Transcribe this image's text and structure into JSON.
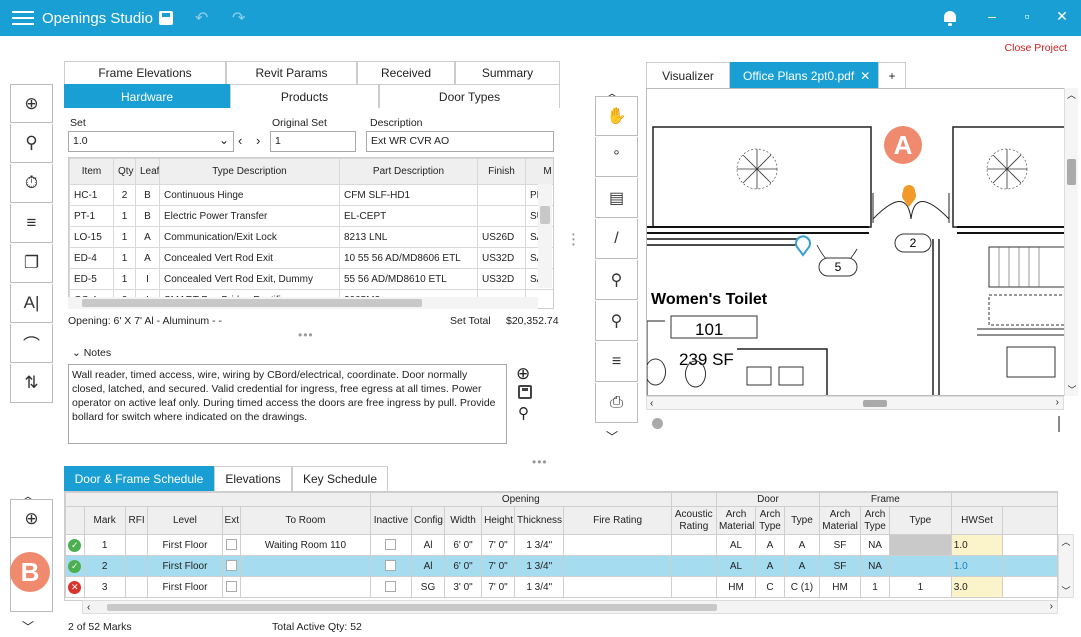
{
  "app": {
    "title": "Openings Studio",
    "close_project": "Close Project"
  },
  "left_toolbar": [
    {
      "icon": "add-icon",
      "glyph": "⊕"
    },
    {
      "icon": "search-icon",
      "glyph": "⚲"
    },
    {
      "icon": "timer-icon",
      "glyph": "⏱"
    },
    {
      "icon": "filter-icon",
      "glyph": "≡"
    },
    {
      "icon": "copy-icon",
      "glyph": "❐"
    },
    {
      "icon": "text-edit-icon",
      "glyph": "A|"
    },
    {
      "icon": "attach-icon",
      "glyph": "⌒"
    },
    {
      "icon": "sort-icon",
      "glyph": "⇅"
    }
  ],
  "tabs_top": [
    "Frame Elevations",
    "Revit Params",
    "Received",
    "Summary"
  ],
  "tabs_second": [
    "Hardware",
    "Products",
    "Door Types"
  ],
  "set": {
    "label": "Set",
    "value": "1.0",
    "original_label": "Original Set",
    "original_value": "1",
    "desc_label": "Description",
    "desc_value": "Ext WR CVR AO"
  },
  "hardware": {
    "headers": [
      "Item",
      "Qty",
      "Leaf",
      "Type Description",
      "Part Description",
      "Finish",
      "M"
    ],
    "rows": [
      [
        "HC-1",
        "2",
        "B",
        "Continuous Hinge",
        "CFM SLF-HD1",
        "",
        "PE"
      ],
      [
        "PT-1",
        "1",
        "B",
        "Electric Power Transfer",
        "EL-CEPT",
        "",
        "SU"
      ],
      [
        "LO-15",
        "1",
        "A",
        "Communication/Exit Lock",
        "8213 LNL",
        "US26D",
        "SA"
      ],
      [
        "ED-4",
        "1",
        "A",
        "Concealed Vert Rod Exit",
        "10 55 56 AD/MD8606 ETL",
        "US32D",
        "SA"
      ],
      [
        "ED-5",
        "1",
        "I",
        "Concealed Vert Rod Exit, Dummy",
        "55 56 AD/MD8610 ETL",
        "US32D",
        "SA"
      ],
      [
        "CC 4",
        "2",
        "I",
        "SMART Pac Bridge Rectifier",
        "2005M3",
        "",
        ""
      ]
    ],
    "opening": "Opening:  6' X 7' Al - Aluminum -  -",
    "set_total_label": "Set Total",
    "set_total": "$20,352.74"
  },
  "notes": {
    "label": "Notes",
    "text": "Wall reader, timed access, wire, wiring by CBord/electrical, coordinate.  Door normally closed, latched, and secured.  Valid credential for ingress, free egress at all times.  Power operator on active leaf only.  During timed access the doors are free ingress by pull.  Provide bollard for switch where indicated on the drawings."
  },
  "viewer": {
    "tab1": "Visualizer",
    "tab2": "Office Plans 2pt0.pdf",
    "add": "+",
    "room_name": "Women's Toilet",
    "room_num": "101",
    "room_area": "239 SF",
    "tag1": "2",
    "tag2": "5",
    "badge_a": "A",
    "badge_b": "B"
  },
  "right_toolbar": [
    {
      "icon": "hand-icon",
      "glyph": "✋"
    },
    {
      "icon": "degree-icon",
      "glyph": "°"
    },
    {
      "icon": "document-search-icon",
      "glyph": "▤"
    },
    {
      "icon": "line-icon",
      "glyph": "/"
    },
    {
      "icon": "pin-icon",
      "glyph": "⚲"
    },
    {
      "icon": "pin-list-icon",
      "glyph": "⚲"
    },
    {
      "icon": "menu-icon",
      "glyph": "≡"
    },
    {
      "icon": "stamp-icon",
      "glyph": "⎙"
    }
  ],
  "sched_tabs": [
    "Door & Frame Schedule",
    "Elevations",
    "Key Schedule"
  ],
  "schedule": {
    "groups": {
      "opening": "Opening",
      "door": "Door",
      "frame": "Frame"
    },
    "headers": [
      "Mark",
      "RFI",
      "Level",
      "Ext",
      "To Room",
      "Inactive",
      "Config",
      "Width",
      "Height",
      "Thickness",
      "Fire Rating",
      "Acoustic Rating",
      "Arch Material",
      "Arch Type",
      "Type",
      "Arch Material",
      "Arch Type",
      "Type",
      "HWSet"
    ],
    "rows": [
      {
        "status": "ok",
        "cells": [
          "1",
          "",
          "First Floor",
          "",
          "Waiting Room 110",
          "",
          "Al",
          "6' 0\"",
          "7' 0\"",
          "1 3/4\"",
          "",
          "",
          "AL",
          "A",
          "A",
          "SF",
          "NA",
          "",
          "1.0"
        ]
      },
      {
        "status": "ok",
        "cells": [
          "2",
          "",
          "First Floor",
          "",
          "",
          "",
          "Al",
          "6' 0\"",
          "7' 0\"",
          "1 3/4\"",
          "",
          "",
          "AL",
          "A",
          "A",
          "SF",
          "NA",
          "",
          "1.0"
        ]
      },
      {
        "status": "err",
        "cells": [
          "3",
          "",
          "First Floor",
          "",
          "",
          "",
          "SG",
          "3' 0\"",
          "7' 0\"",
          "1 3/4\"",
          "",
          "",
          "HM",
          "C",
          "C (1)",
          "HM",
          "1",
          "1",
          "3.0"
        ]
      }
    ],
    "marks": "2 of 52 Marks",
    "total": "Total Active Qty: 52"
  },
  "colors": {
    "accent": "#1a9fd4",
    "selected_row": "#a6dcef",
    "badge": "#ef8a6f"
  }
}
